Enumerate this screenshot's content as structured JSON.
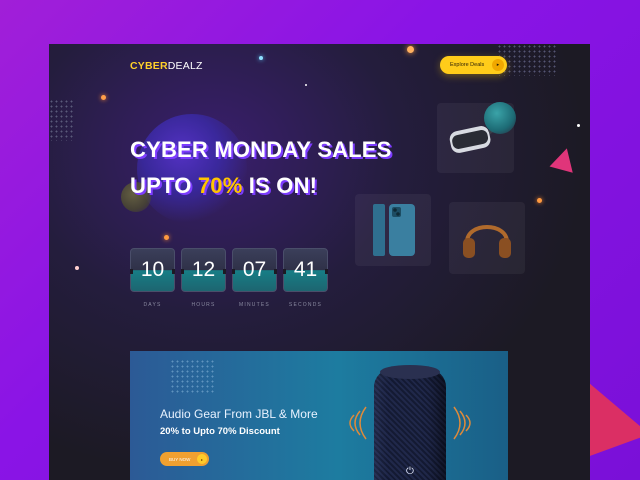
{
  "header": {
    "logo_part1": "CYBER",
    "logo_part2": "DEALZ",
    "cta_label": "Explore Deals",
    "cta_icon": "chevron-right-icon"
  },
  "hero": {
    "line1": "CYBER MONDAY SALES",
    "line2_prefix": "UPTO ",
    "line2_highlight": "70%",
    "line2_suffix": " IS ON!"
  },
  "countdown": [
    {
      "value": "10",
      "label": "DAYS"
    },
    {
      "value": "12",
      "label": "HOURS"
    },
    {
      "value": "07",
      "label": "MINUTES"
    },
    {
      "value": "41",
      "label": "SECONDS"
    }
  ],
  "products": {
    "tile1": "vr-headset-icon",
    "tile2": "smartphone-icon",
    "tile3": "headphones-icon"
  },
  "banner": {
    "title": "Audio Gear From JBL & More",
    "subtitle": "20% to Upto 70% Discount",
    "button_label": "BUY NOW",
    "button_icon": "chevron-right-icon",
    "product_icon": "speaker-icon"
  },
  "colors": {
    "accent_yellow": "#ffc400",
    "headline_shadow": "#7d3cff",
    "page_bg": "#1c1a24",
    "outer_bg": "#8a14e6",
    "banner_blue": "#1d7ca0",
    "buy_orange": "#f0a030"
  }
}
